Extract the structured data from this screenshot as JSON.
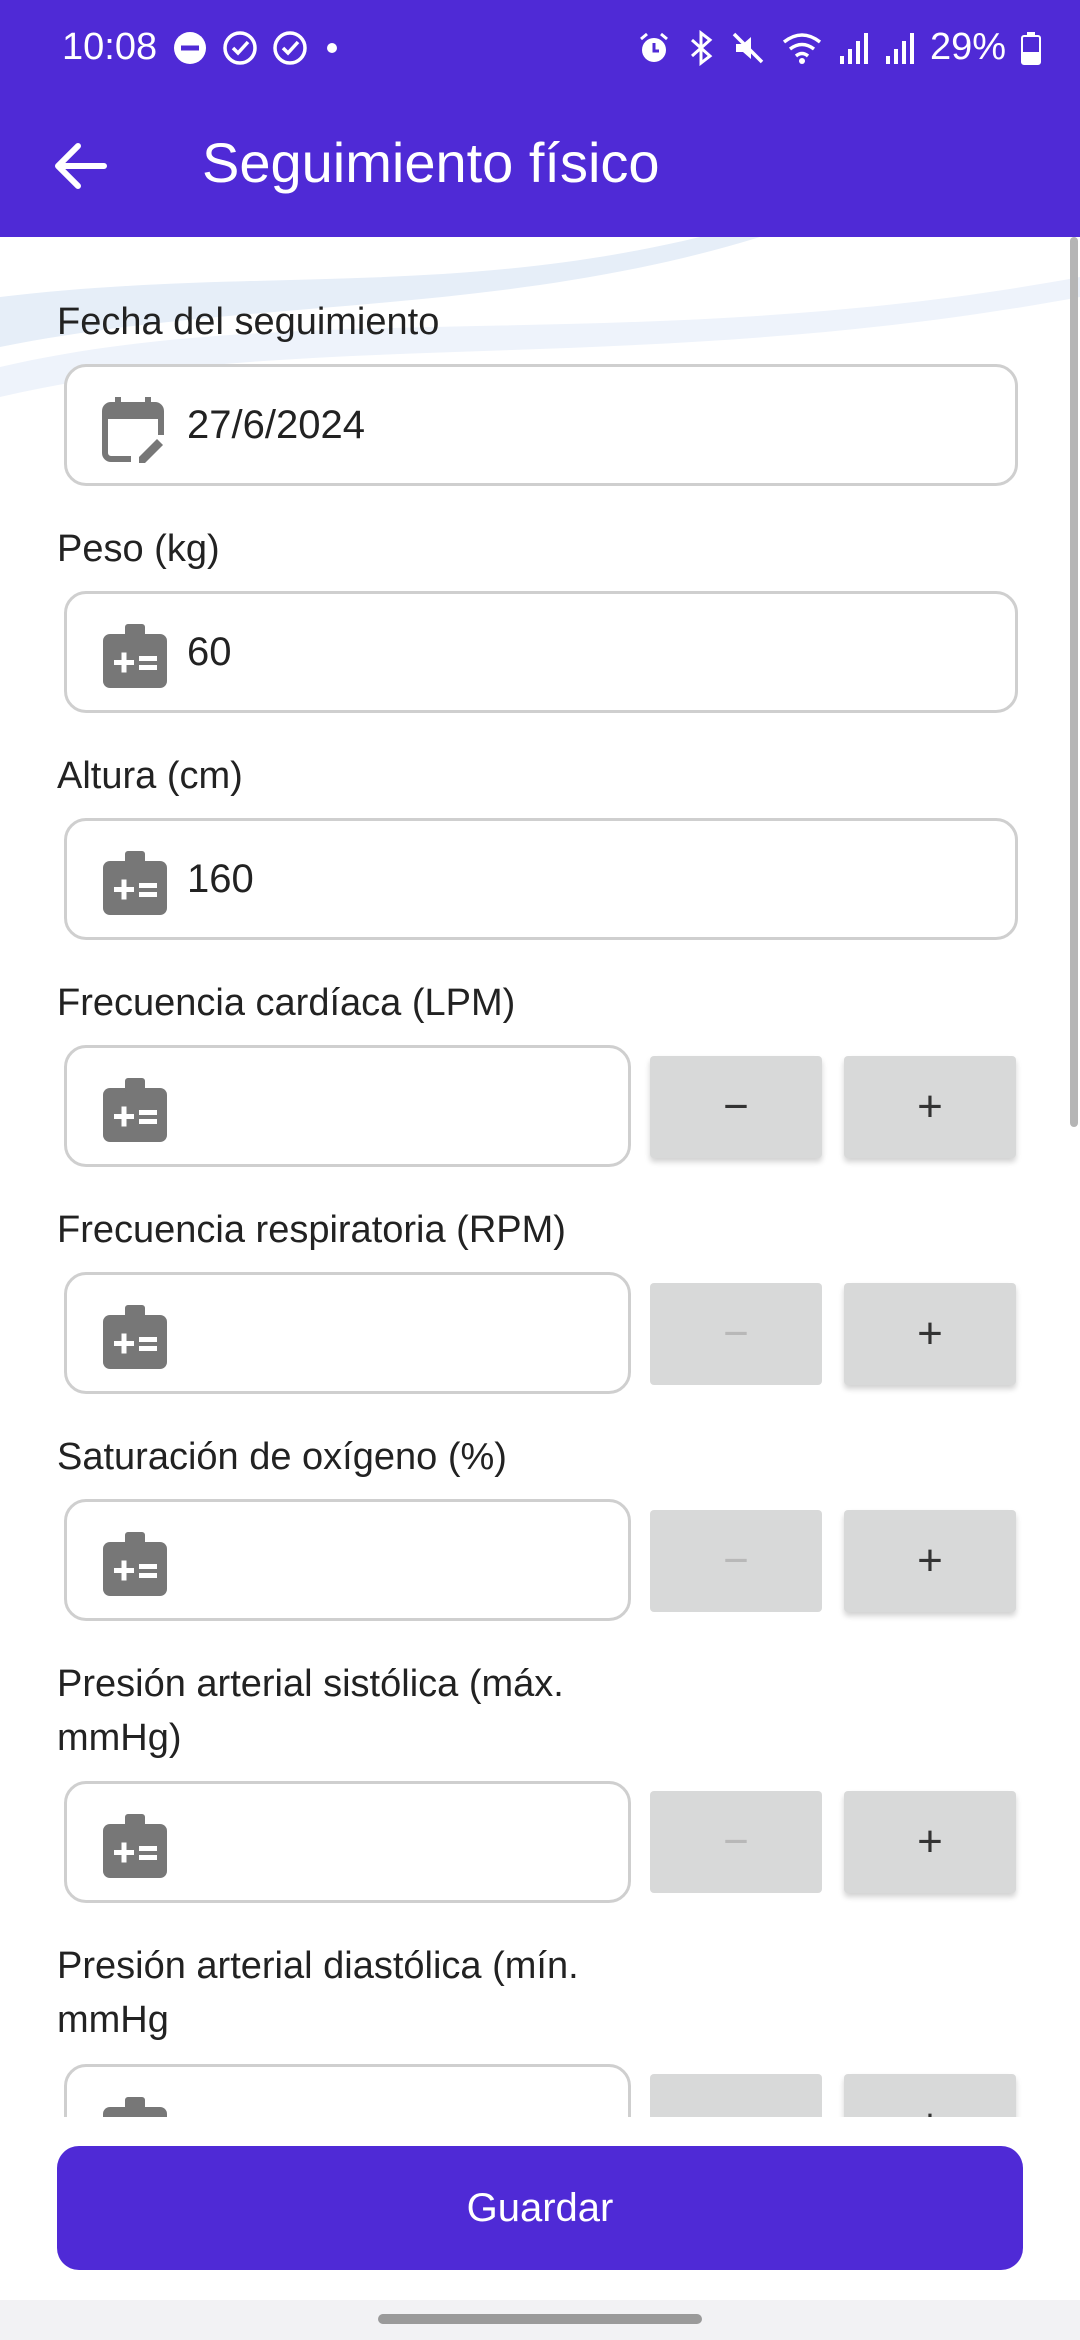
{
  "status_bar": {
    "time": "10:08",
    "battery": "29%",
    "left_icons": [
      "dnd-icon",
      "check-circle-icon",
      "check-circle-icon",
      "dot-icon"
    ],
    "right_icons": [
      "alarm-icon",
      "bluetooth-icon",
      "mute-icon",
      "wifi-icon",
      "signal-icon",
      "signal-icon",
      "battery-icon"
    ]
  },
  "app_bar": {
    "title": "Seguimiento físico",
    "back_icon": "arrow-left-icon"
  },
  "form": {
    "date": {
      "label": "Fecha del seguimiento",
      "value": "27/6/2024",
      "icon": "calendar-edit-icon"
    },
    "weight": {
      "label": "Peso (kg)",
      "value": "60",
      "icon": "medical-kit-icon"
    },
    "height": {
      "label": "Altura (cm)",
      "value": "160",
      "icon": "medical-kit-icon"
    },
    "heart_rate": {
      "label": "Frecuencia cardíaca (LPM)",
      "value": "",
      "minus": "−",
      "plus": "+",
      "minus_enabled": true
    },
    "resp_rate": {
      "label": "Frecuencia respiratoria (RPM)",
      "value": "",
      "minus": "−",
      "plus": "+",
      "minus_enabled": false
    },
    "oxygen": {
      "label": "Saturación de oxígeno (%)",
      "value": "",
      "minus": "−",
      "plus": "+",
      "minus_enabled": false
    },
    "systolic": {
      "label_line1": "Presión arterial sistólica (máx.",
      "label_line2": "mmHg)",
      "value": "",
      "minus": "−",
      "plus": "+",
      "minus_enabled": false
    },
    "diastolic": {
      "label_line1": "Presión arterial diastólica (mín.",
      "label_line2": "mmHg",
      "value": "",
      "minus": "−",
      "plus": "+"
    }
  },
  "save_button": "Guardar",
  "colors": {
    "primary": "#4f2ad6",
    "field_border": "#cfcfcf",
    "button_bg": "#d8d9d9"
  }
}
